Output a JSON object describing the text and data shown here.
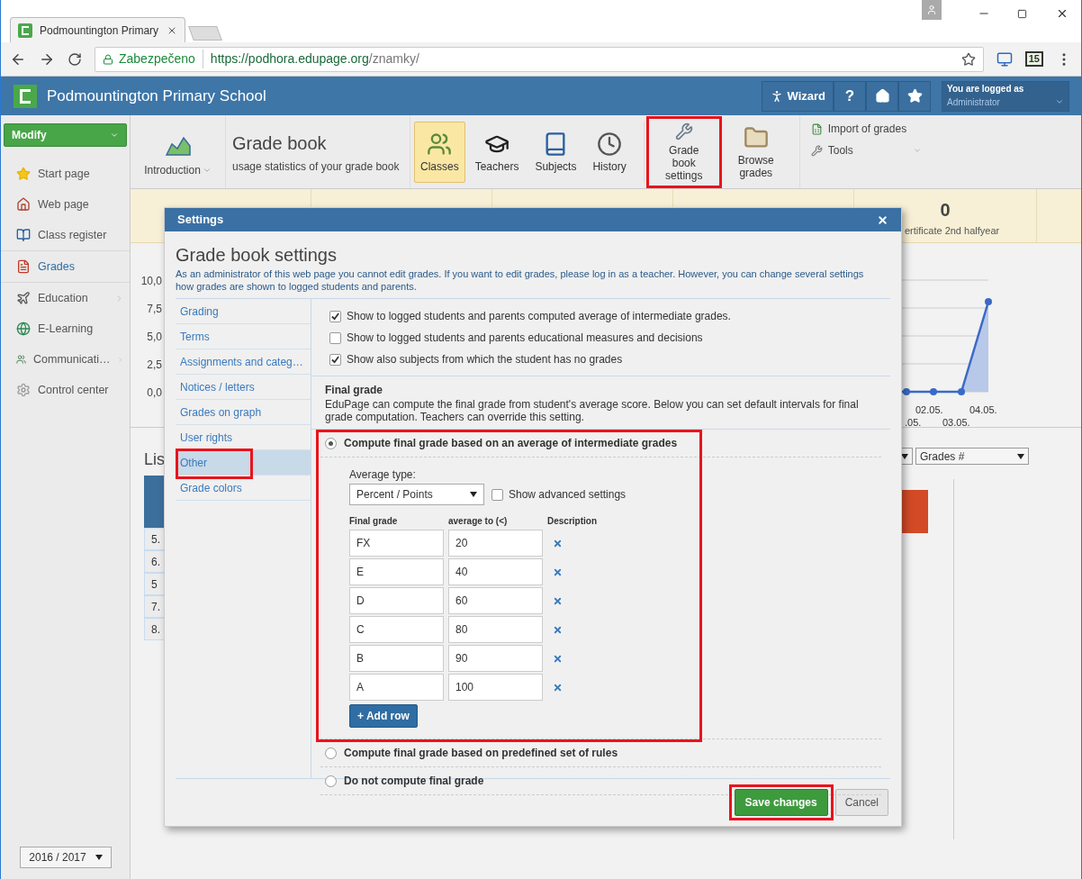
{
  "browser": {
    "tab_title": "Podmountington Primary",
    "security": "Zabezpečeno",
    "url_host": "https://podhora.edupage.org",
    "url_path": "/znamky/",
    "extension_badge": "15"
  },
  "header": {
    "school": "Podmountington Primary School",
    "wizard": "Wizard",
    "help": "?",
    "login_label": "You are logged as",
    "login_user": "Administrator"
  },
  "sidebar": {
    "modify": "Modify",
    "groups": [
      [
        {
          "label": "Start page",
          "selected": false,
          "submenu": false
        },
        {
          "label": "Web page",
          "selected": false,
          "submenu": false
        },
        {
          "label": "Class register",
          "selected": false,
          "submenu": false
        }
      ],
      [
        {
          "label": "Grades",
          "selected": true,
          "submenu": false
        }
      ],
      [
        {
          "label": "Education",
          "selected": false,
          "submenu": true
        },
        {
          "label": "E-Learning",
          "selected": false,
          "submenu": false
        },
        {
          "label": "Communicati…",
          "selected": false,
          "submenu": true
        },
        {
          "label": "Control center",
          "selected": false,
          "submenu": false
        }
      ]
    ],
    "year": "2016 / 2017"
  },
  "toolbar": {
    "intro": "Introduction",
    "title": "Grade book",
    "subtitle": "usage statistics of your grade book",
    "buttons": [
      {
        "label": "Classes",
        "selected": true,
        "highlighted": false
      },
      {
        "label": "Teachers",
        "selected": false,
        "highlighted": false
      },
      {
        "label": "Subjects",
        "selected": false,
        "highlighted": false
      },
      {
        "label": "History",
        "selected": false,
        "highlighted": false
      },
      {
        "label": "Grade book settings",
        "selected": false,
        "highlighted": true
      },
      {
        "label": "Browse grades",
        "selected": false,
        "highlighted": false
      }
    ],
    "links": [
      "Import of grades",
      "Tools"
    ]
  },
  "stats": {
    "value": "0",
    "label": "ertificate 2nd halfyear"
  },
  "chart": {
    "y_labels": [
      "10,0",
      "7,5",
      "5,0",
      "2,5",
      "0,0"
    ],
    "x_labels_upper": [
      "02.05.",
      "04.05."
    ],
    "x_labels_lower": [
      ".05.",
      "03.05."
    ]
  },
  "list": {
    "heading": "Lis",
    "rows": [
      "5.",
      "6.",
      "5",
      "7.",
      "8."
    ],
    "select": "Grades #"
  },
  "modal": {
    "title": "Settings",
    "heading": "Grade book settings",
    "description": "As an administrator of this web page you cannot edit grades. If you want to edit grades, please log in as a teacher. However, you can change several settings how grades are shown to logged students and parents.",
    "nav": [
      {
        "label": "Grading",
        "selected": false,
        "highlighted": false
      },
      {
        "label": "Terms",
        "selected": false,
        "highlighted": false
      },
      {
        "label": "Assignments and categ…",
        "selected": false,
        "highlighted": false
      },
      {
        "label": "Notices / letters",
        "selected": false,
        "highlighted": false
      },
      {
        "label": "Grades on graph",
        "selected": false,
        "highlighted": false
      },
      {
        "label": "User rights",
        "selected": false,
        "highlighted": false
      },
      {
        "label": "Other",
        "selected": true,
        "highlighted": true
      },
      {
        "label": "Grade colors",
        "selected": false,
        "highlighted": false
      }
    ],
    "checks": [
      {
        "label": "Show to logged students and parents computed average of intermediate grades.",
        "checked": true
      },
      {
        "label": "Show to logged students and parents educational measures and decisions",
        "checked": false
      },
      {
        "label": "Show also subjects from which the student has no grades",
        "checked": true
      }
    ],
    "final_title": "Final grade",
    "final_text": "EduPage can compute the final grade from student's average score. Below you can set default intervals for final grade computation. Teachers can override this setting.",
    "options": [
      {
        "label": "Compute final grade based on an average of intermediate grades",
        "selected": true,
        "highlighted": true
      },
      {
        "label": "Compute final grade based on predefined set of rules",
        "selected": false,
        "highlighted": false
      },
      {
        "label": "Do not compute final grade",
        "selected": false,
        "highlighted": false
      }
    ],
    "average_label": "Average type:",
    "average_value": "Percent / Points",
    "advanced": {
      "label": "Show advanced settings",
      "checked": false
    },
    "columns": [
      "Final grade",
      "average to (<)",
      "Description"
    ],
    "grades": [
      {
        "grade": "FX",
        "limit": "20"
      },
      {
        "grade": "E",
        "limit": "40"
      },
      {
        "grade": "D",
        "limit": "60"
      },
      {
        "grade": "C",
        "limit": "80"
      },
      {
        "grade": "B",
        "limit": "90"
      },
      {
        "grade": "A",
        "limit": "100"
      }
    ],
    "add_row": "+ Add row",
    "save": {
      "label": "Save changes",
      "highlighted": true
    },
    "cancel": "Cancel"
  }
}
